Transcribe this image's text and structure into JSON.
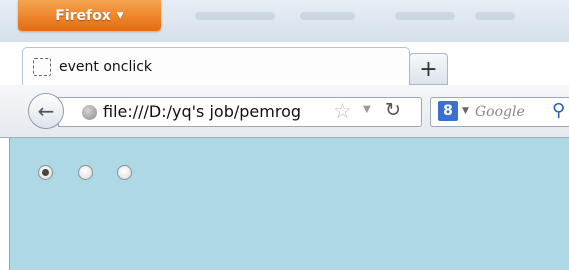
{
  "browser": {
    "app_button_label": "Firefox",
    "app_button_arrow": "▼"
  },
  "tabs": [
    {
      "label": "event onclick",
      "icon": "blank-page-icon"
    }
  ],
  "new_tab_label": "+",
  "navbar": {
    "back_icon": "back-arrow-icon",
    "url": "file:///D:/yq's job/pemrog",
    "search_engine_icon": "8",
    "search_placeholder": "Google"
  },
  "content": {
    "background": "#add8e6",
    "radios": [
      {
        "checked": true
      },
      {
        "checked": false
      },
      {
        "checked": false
      }
    ]
  }
}
